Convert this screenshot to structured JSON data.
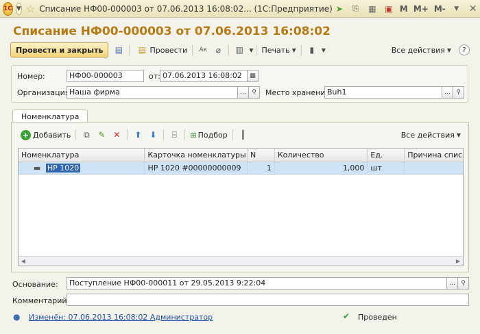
{
  "window": {
    "title": "Списание НФ00-000003 от 07.06.2013 16:08:02... (1С:Предприятие)",
    "logo": "1С",
    "buttons": [
      "M",
      "M+",
      "M-"
    ]
  },
  "heading": "Списание НФ00-000003 от 07.06.2013 16:08:02",
  "toolbar": {
    "post_close": "Провести и закрыть",
    "post": "Провести",
    "print": "Печать",
    "all_actions": "Все действия",
    "help": "?"
  },
  "form": {
    "number_label": "Номер:",
    "number_value": "НФ00-000003",
    "date_label": "от:",
    "date_value": "07.06.2013 16:08:02",
    "org_label": "Организация:",
    "org_value": "Наша фирма",
    "storage_label": "Место хранения:",
    "storage_value": "Buh1"
  },
  "tab": {
    "label": "Номенклатура"
  },
  "grid_toolbar": {
    "add": "Добавить",
    "selection": "Подбор",
    "all_actions": "Все действия"
  },
  "grid": {
    "columns": [
      "Номенклатура",
      "Карточка номенклатуры",
      "N",
      "Количество",
      "Ед.",
      "Причина списа"
    ],
    "rows": [
      {
        "item": "HP 1020",
        "card": "HP 1020 #00000000009",
        "n": "1",
        "qty": "1,000",
        "unit": "шт",
        "reason": ""
      }
    ]
  },
  "footer": {
    "basis_label": "Основание:",
    "basis_value": "Поступление НФ00-000011 от 29.05.2013 9:22:04",
    "comment_label": "Комментарий:",
    "comment_value": "",
    "changed_link": "Изменён: 07.06.2013 16:08:02 Администратор",
    "status": "Проведен"
  },
  "colors": {
    "heading": "#b47a14",
    "selection": "#cfe3f7",
    "link": "#1a4fa5"
  }
}
